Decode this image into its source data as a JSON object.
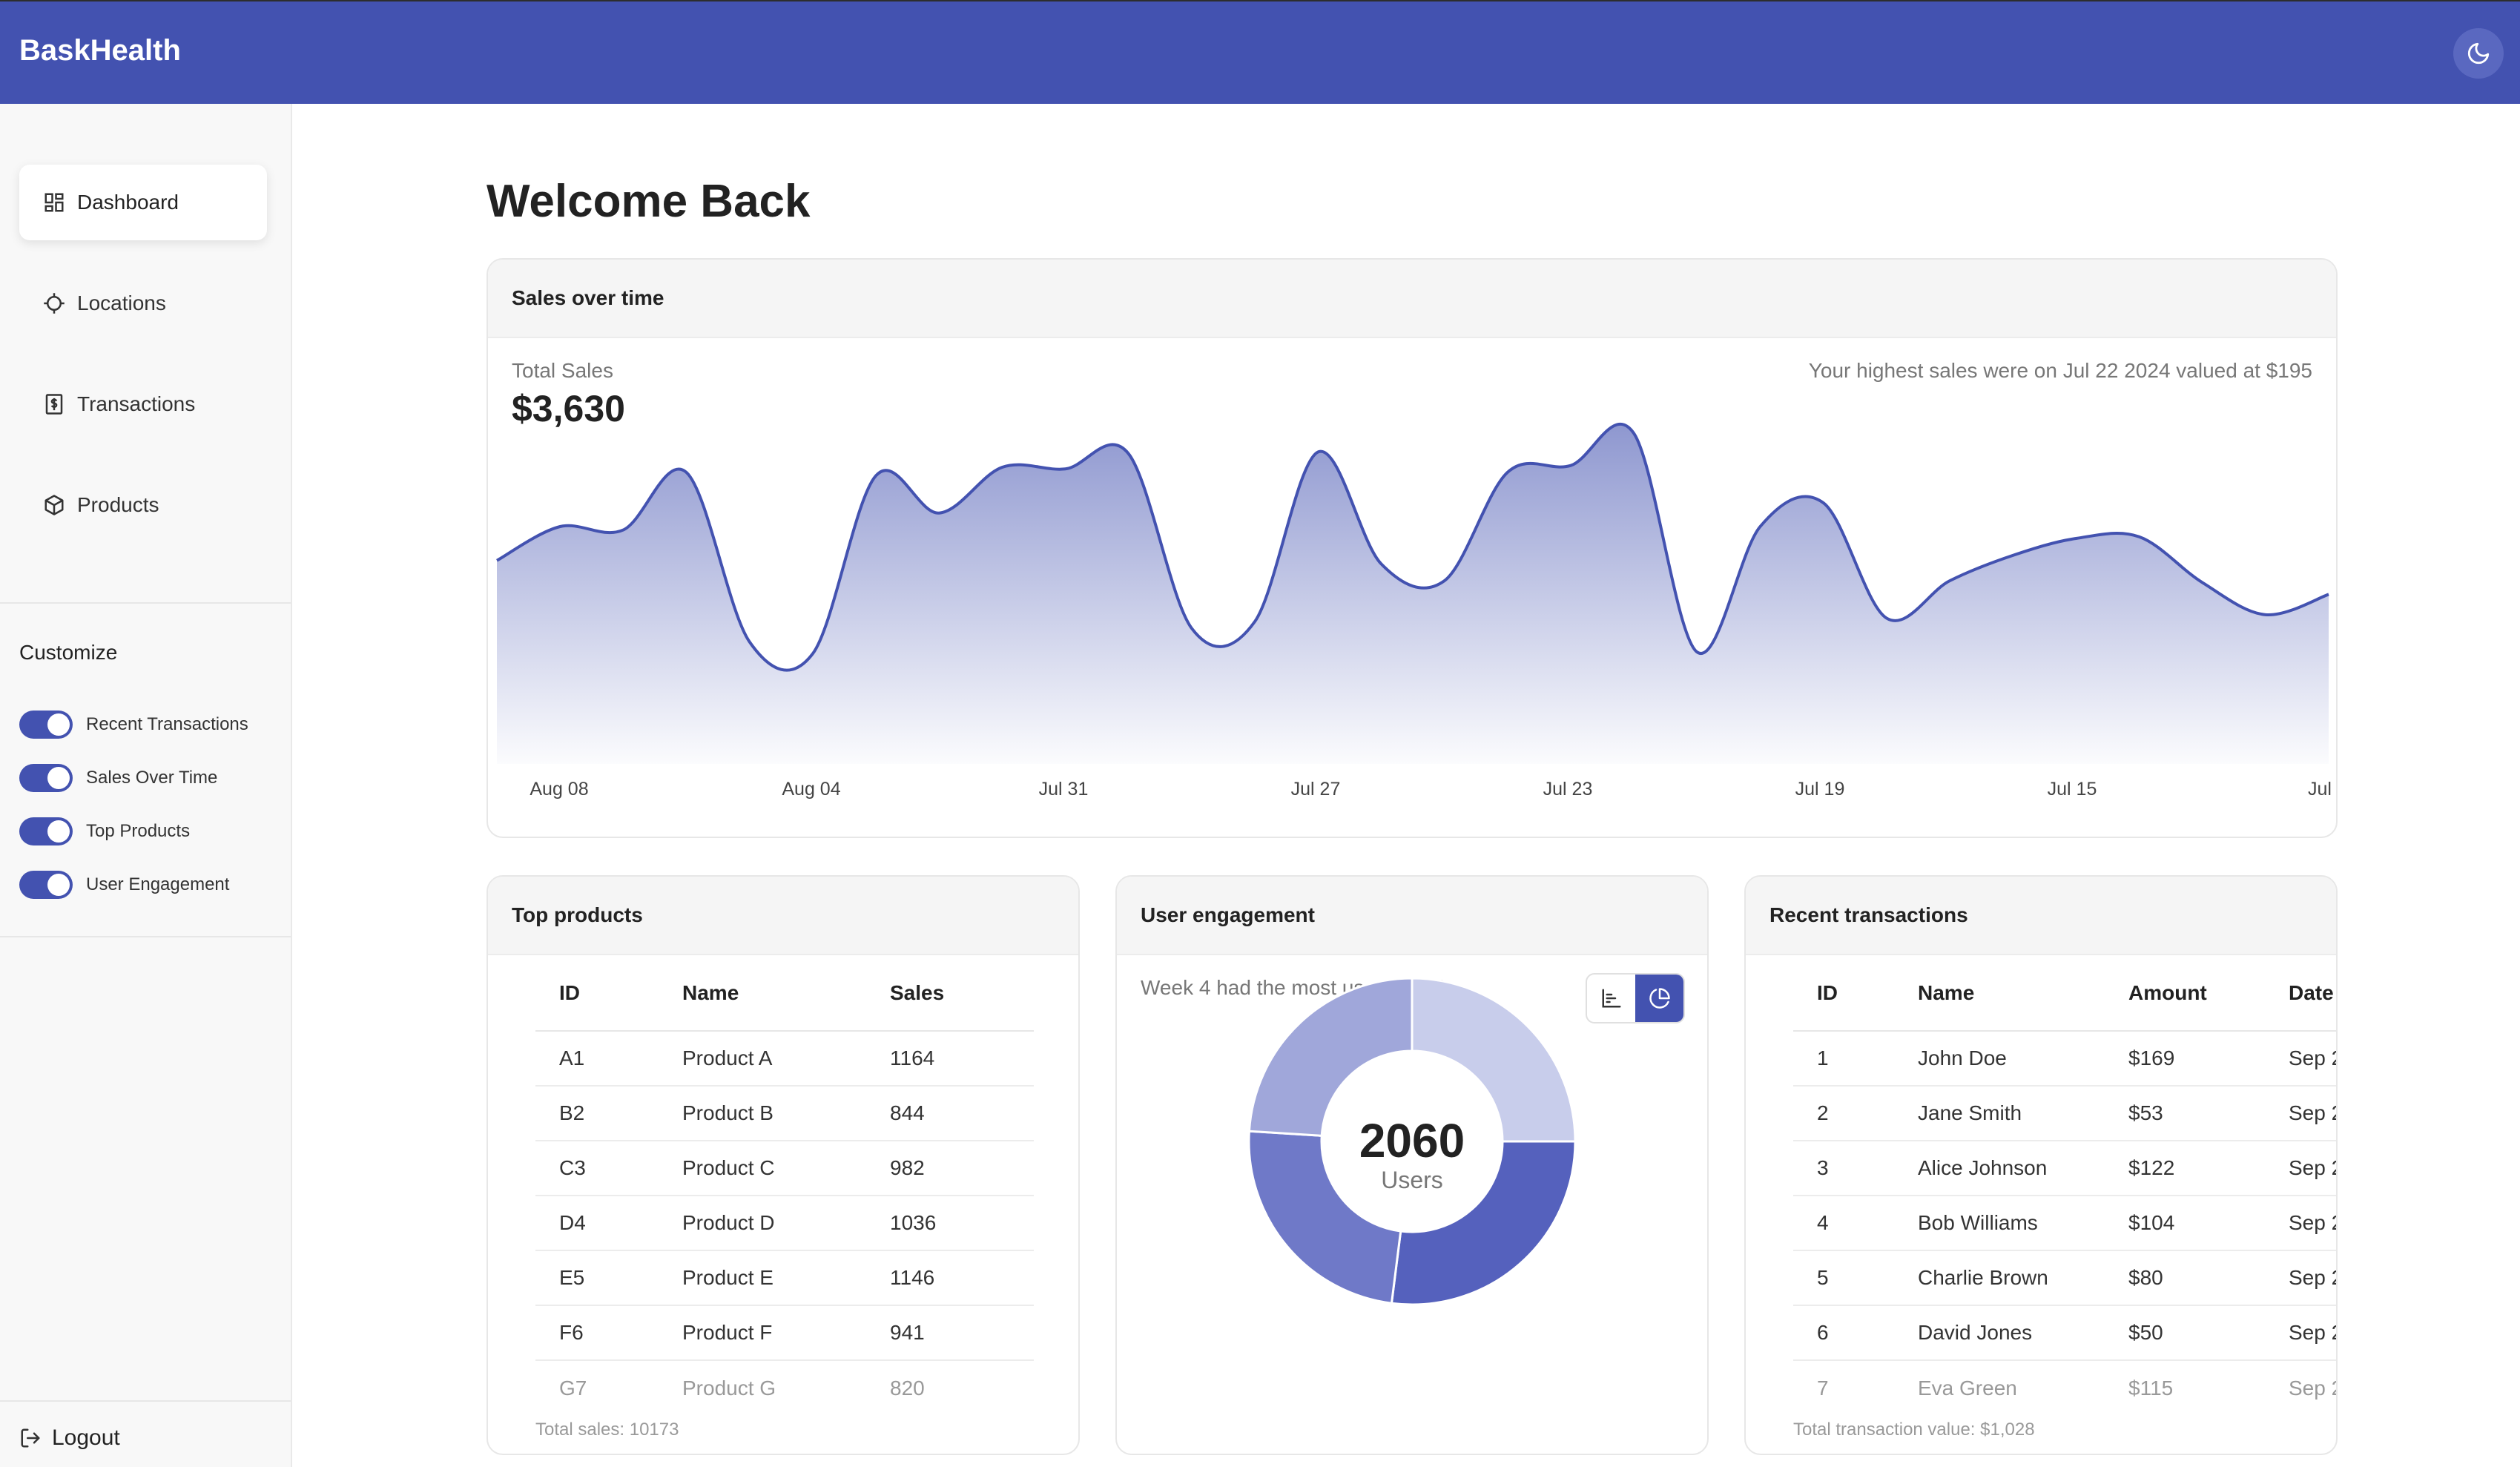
{
  "app": {
    "brand": "BaskHealth"
  },
  "topbar": {
    "theme_icon": "moon-icon"
  },
  "sidebar": {
    "items": [
      {
        "label": "Dashboard",
        "icon": "grid-icon",
        "active": true
      },
      {
        "label": "Locations",
        "icon": "crosshair-icon",
        "active": false
      },
      {
        "label": "Transactions",
        "icon": "receipt-icon",
        "active": false
      },
      {
        "label": "Products",
        "icon": "box-icon",
        "active": false
      }
    ],
    "customize": {
      "title": "Customize",
      "toggles": [
        {
          "label": "Recent Transactions",
          "on": true
        },
        {
          "label": "Sales Over Time",
          "on": true
        },
        {
          "label": "Top Products",
          "on": true
        },
        {
          "label": "User Engagement",
          "on": true
        }
      ]
    },
    "logout_label": "Logout"
  },
  "page": {
    "title": "Welcome Back"
  },
  "sales": {
    "title": "Sales over time",
    "total_label": "Total Sales",
    "total_value": "$3,630",
    "highest_note": "Your highest sales were on Jul 22 2024 valued at $195"
  },
  "chart_data": {
    "type": "area",
    "title": "Sales over time",
    "x_ticks": [
      "Aug 08",
      "Aug 04",
      "Jul 31",
      "Jul 27",
      "Jul 23",
      "Jul 19",
      "Jul 15",
      "Jul"
    ],
    "y_axis_shown": false,
    "grid": false,
    "color": "#4352b0",
    "points": [
      {
        "x": "Aug 09",
        "y": 120
      },
      {
        "x": "Aug 08",
        "y": 140
      },
      {
        "x": "Aug 07",
        "y": 138
      },
      {
        "x": "Aug 06",
        "y": 172
      },
      {
        "x": "Aug 05",
        "y": 72
      },
      {
        "x": "Aug 04",
        "y": 65
      },
      {
        "x": "Aug 03",
        "y": 170
      },
      {
        "x": "Aug 02",
        "y": 148
      },
      {
        "x": "Aug 01",
        "y": 175
      },
      {
        "x": "Jul 31",
        "y": 174
      },
      {
        "x": "Jul 30",
        "y": 183
      },
      {
        "x": "Jul 29",
        "y": 80
      },
      {
        "x": "Jul 28",
        "y": 84
      },
      {
        "x": "Jul 27",
        "y": 184
      },
      {
        "x": "Jul 26",
        "y": 118
      },
      {
        "x": "Jul 25",
        "y": 108
      },
      {
        "x": "Jul 24",
        "y": 172
      },
      {
        "x": "Jul 23",
        "y": 176
      },
      {
        "x": "Jul 22",
        "y": 195
      },
      {
        "x": "Jul 21",
        "y": 66
      },
      {
        "x": "Jul 20",
        "y": 140
      },
      {
        "x": "Jul 19",
        "y": 154
      },
      {
        "x": "Jul 18",
        "y": 86
      },
      {
        "x": "Jul 17",
        "y": 108
      },
      {
        "x": "Jul 16",
        "y": 123
      },
      {
        "x": "Jul 15",
        "y": 133
      },
      {
        "x": "Jul 14",
        "y": 134
      },
      {
        "x": "Jul 13",
        "y": 107
      },
      {
        "x": "Jul 12",
        "y": 88
      },
      {
        "x": "Jul 11",
        "y": 100
      }
    ]
  },
  "top_products": {
    "title": "Top products",
    "columns": [
      "ID",
      "Name",
      "Sales"
    ],
    "rows": [
      [
        "A1",
        "Product A",
        "1164"
      ],
      [
        "B2",
        "Product B",
        "844"
      ],
      [
        "C3",
        "Product C",
        "982"
      ],
      [
        "D4",
        "Product D",
        "1036"
      ],
      [
        "E5",
        "Product E",
        "1146"
      ],
      [
        "F6",
        "Product F",
        "941"
      ],
      [
        "G7",
        "Product G",
        "820"
      ]
    ],
    "footer": "Total sales: 10173"
  },
  "engagement": {
    "title": "User engagement",
    "note": "Week 4 had the most users (568)",
    "view_options": [
      {
        "icon": "bar-chart-icon",
        "selected": false
      },
      {
        "icon": "pie-chart-icon",
        "selected": true
      }
    ],
    "center_value": "2060",
    "center_label": "Users",
    "slices": [
      {
        "value": 0.25,
        "color": "#c8cdeb"
      },
      {
        "value": 0.27,
        "color": "#5561bd"
      },
      {
        "value": 0.24,
        "color": "#6f79c8"
      },
      {
        "value": 0.24,
        "color": "#a0a7da"
      }
    ]
  },
  "transactions": {
    "title": "Recent transactions",
    "columns": [
      "ID",
      "Name",
      "Amount",
      "Date"
    ],
    "rows": [
      [
        "1",
        "John Doe",
        "$169",
        "Sep 2"
      ],
      [
        "2",
        "Jane Smith",
        "$53",
        "Sep 2"
      ],
      [
        "3",
        "Alice Johnson",
        "$122",
        "Sep 2"
      ],
      [
        "4",
        "Bob Williams",
        "$104",
        "Sep 2"
      ],
      [
        "5",
        "Charlie Brown",
        "$80",
        "Sep 2"
      ],
      [
        "6",
        "David Jones",
        "$50",
        "Sep 2"
      ],
      [
        "7",
        "Eva Green",
        "$115",
        "Sep 2"
      ]
    ],
    "footer": "Total transaction value: $1,028"
  }
}
